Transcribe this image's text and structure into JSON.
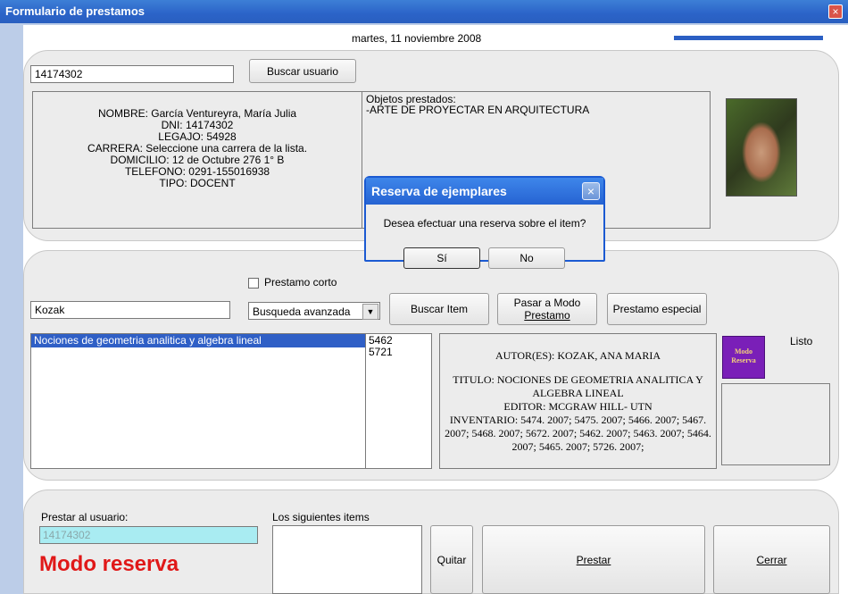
{
  "window": {
    "title": "Formulario de prestamos",
    "close_glyph": "×"
  },
  "header": {
    "date": "martes, 11 noviembre 2008"
  },
  "user_panel": {
    "id_value": "14174302",
    "search_user_label": "Buscar usuario",
    "info_lines": [
      "NOMBRE: García Ventureyra, María Julia",
      "DNI: 14174302",
      "LEGAJO: 54928",
      "CARRERA: Seleccione una carrera de la lista.",
      "DOMICILIO: 12 de Octubre 276 1° B",
      "TELEFONO: 0291-155016938",
      "TIPO: DOCENT"
    ],
    "borrowed_title": "Objetos prestados:",
    "borrowed_items": [
      "-ARTE DE PROYECTAR EN ARQUITECTURA"
    ]
  },
  "item_panel": {
    "short_loan_label": "Prestamo corto",
    "search_value": "Kozak",
    "search_mode": "Busqueda avanzada",
    "search_item_label": "Buscar Item",
    "loan_mode_label_1": "Pasar a Modo",
    "loan_mode_label_2": "Prestamo",
    "special_loan_label": "Prestamo especial",
    "results": [
      "Nociones de geometria analitica y algebra lineal"
    ],
    "codes": [
      "5462",
      "5721"
    ],
    "detail": {
      "author": "AUTOR(ES): KOZAK, ANA MARIA",
      "title": "TITULO: NOCIONES DE GEOMETRIA ANALITICA Y ALGEBRA LINEAL",
      "editor": "EDITOR: MCGRAW HILL- UTN",
      "inventory": "INVENTARIO: 5474. 2007; 5475. 2007; 5466. 2007; 5467. 2007; 5468. 2007; 5672. 2007; 5462. 2007; 5463. 2007; 5464. 2007; 5465. 2007; 5726. 2007;"
    },
    "mode_badge_1": "Modo",
    "mode_badge_2": "Reserva",
    "status": "Listo"
  },
  "loan_panel": {
    "lend_to_label": "Prestar al usuario:",
    "lend_to_value": "14174302",
    "mode_text": "Modo reserva",
    "items_label": "Los siguientes items",
    "remove_label": "Quitar",
    "lend_label": "Prestar",
    "close_label": "Cerrar"
  },
  "dialog": {
    "title": "Reserva de ejemplares",
    "message": "Desea efectuar una reserva sobre el item?",
    "yes_label": "Sí",
    "no_label": "No"
  },
  "colors": {
    "accent": "#2b63c8",
    "mode_red": "#e01818",
    "badge_purple": "#7a1fb8",
    "selection": "#2f5fc6",
    "lend_field": "#a9ecf2"
  }
}
